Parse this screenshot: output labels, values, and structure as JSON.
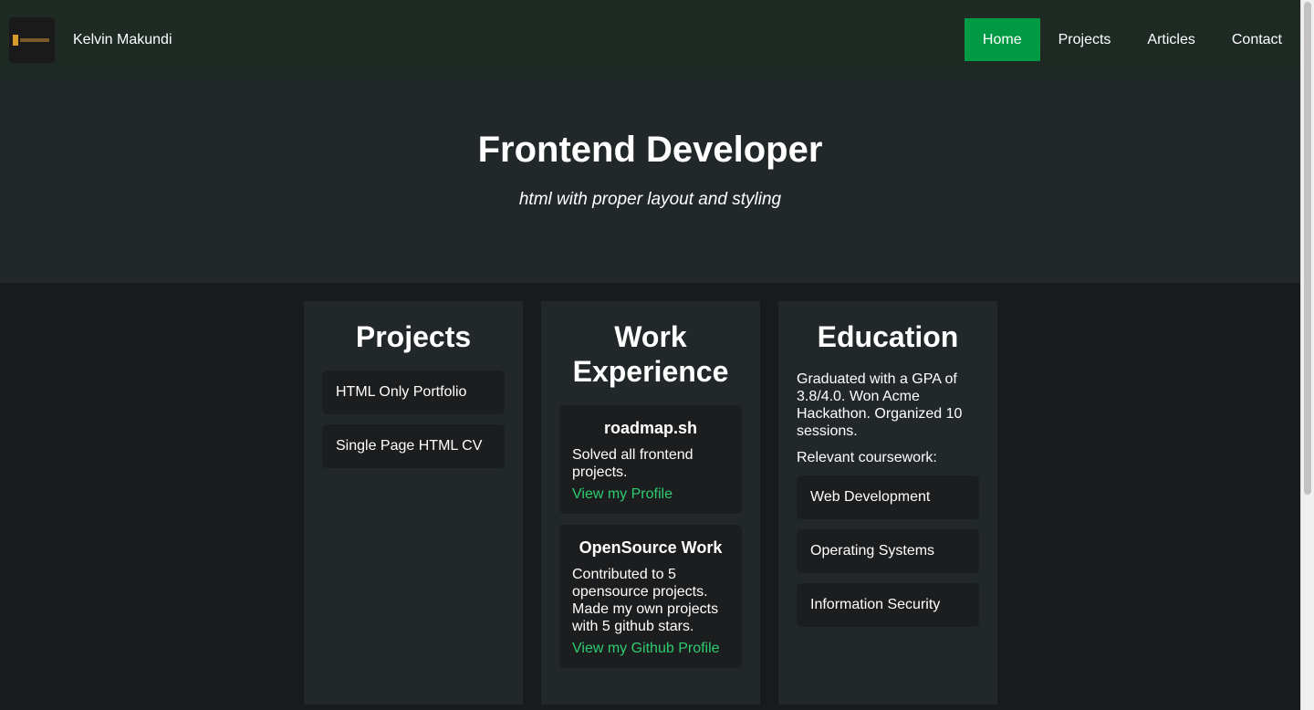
{
  "header": {
    "brand": "Kelvin Makundi",
    "logo_icon": "portfolio-logo-icon",
    "nav": [
      {
        "label": "Home",
        "active": true
      },
      {
        "label": "Projects",
        "active": false
      },
      {
        "label": "Articles",
        "active": false
      },
      {
        "label": "Contact",
        "active": false
      }
    ]
  },
  "hero": {
    "title": "Frontend Developer",
    "subtitle": "html with proper layout and styling"
  },
  "projects": {
    "title": "Projects",
    "items": [
      "HTML Only Portfolio",
      "Single Page HTML CV"
    ]
  },
  "work": {
    "title": "Work Experience",
    "cards": [
      {
        "title": "roadmap.sh",
        "text": "Solved all frontend projects.",
        "link": "View my Profile"
      },
      {
        "title": "OpenSource Work",
        "text": "Contributed to 5 opensource projects. Made my own projects with 5 github stars.",
        "link": "View my Github Profile"
      }
    ]
  },
  "education": {
    "title": "Education",
    "summary": "Graduated with a GPA of 3.8/4.0. Won Acme Hackathon. Organized 10 sessions.",
    "coursework_label": "Relevant coursework:",
    "courses": [
      "Web Development",
      "Operating Systems",
      "Information Security"
    ]
  },
  "colors": {
    "accent": "#009a44",
    "link": "#2ecc71",
    "background": "#171b1c",
    "panel": "#222729"
  }
}
